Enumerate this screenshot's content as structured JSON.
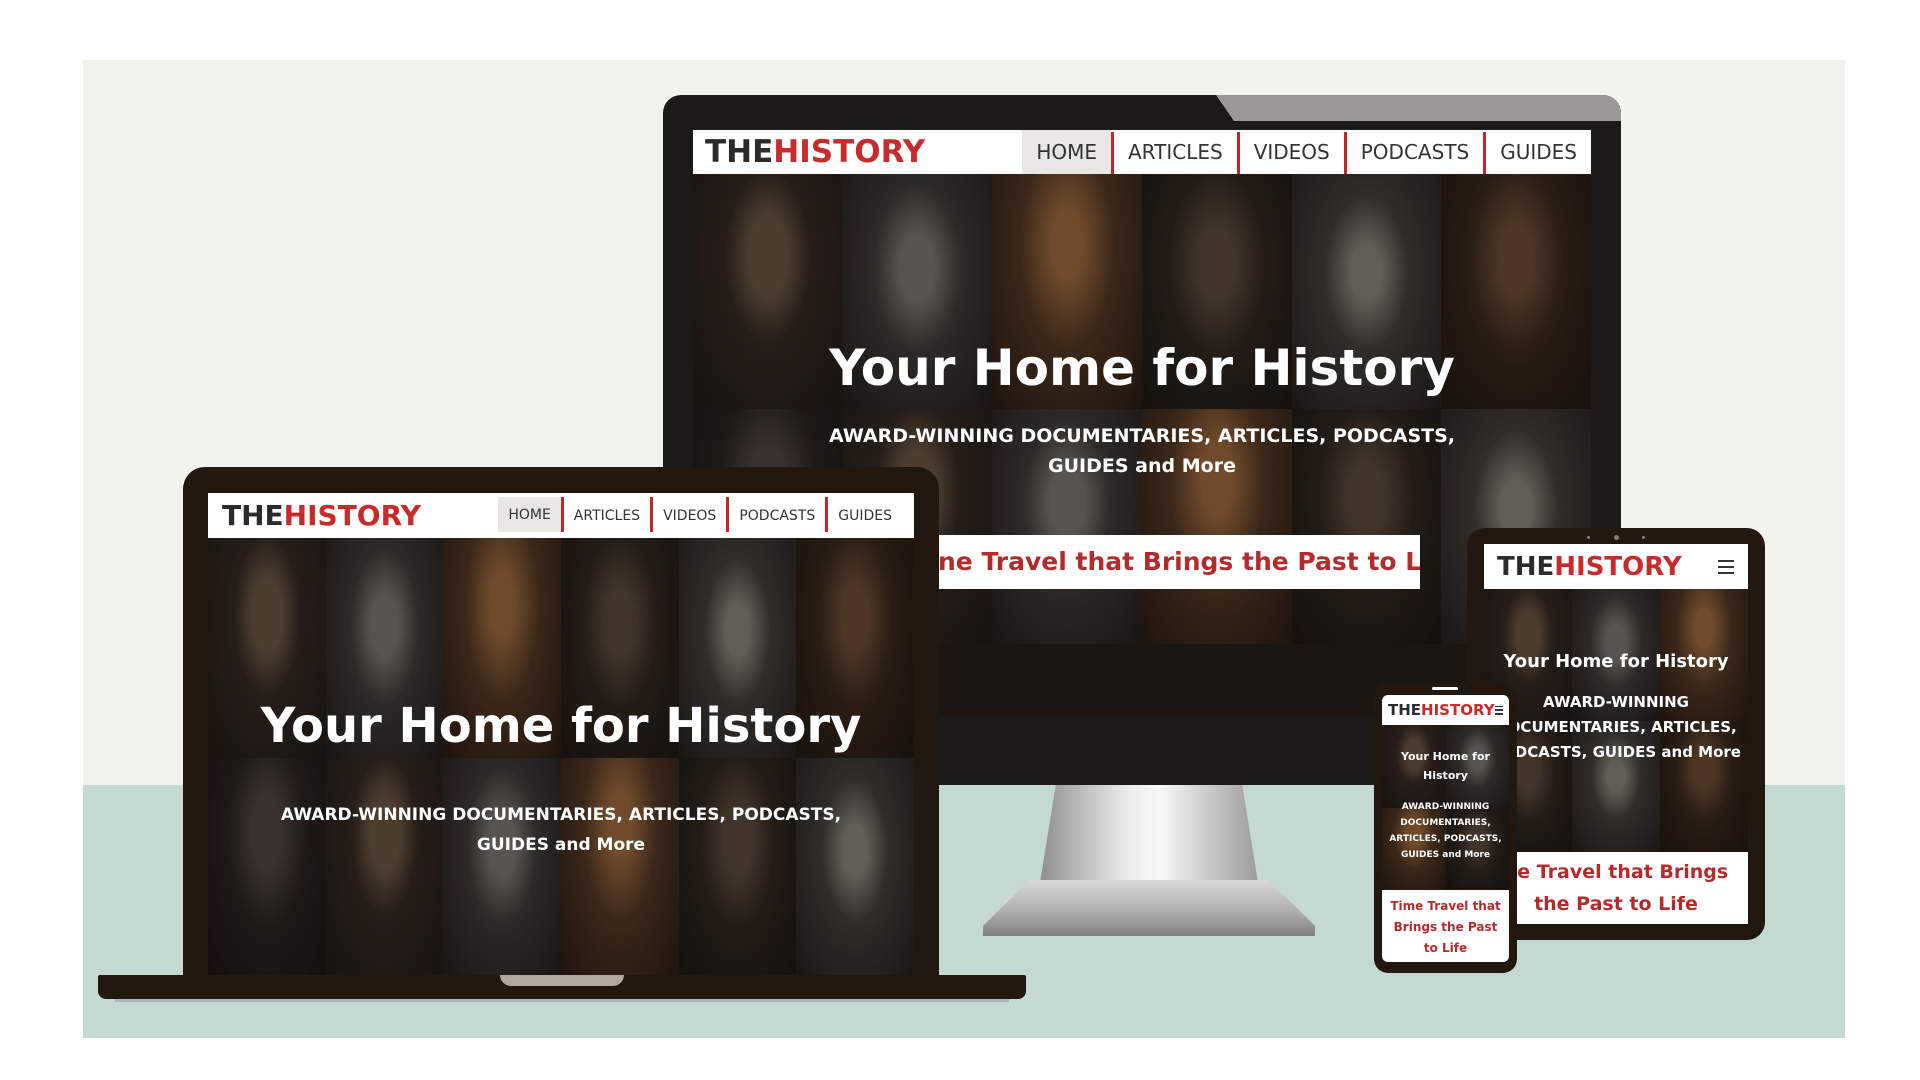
{
  "brand": {
    "logo_the": "THE",
    "logo_history": "HISTORY",
    "accent_color": "#c72b2b"
  },
  "nav": {
    "items": [
      {
        "label": "HOME",
        "active": true
      },
      {
        "label": "ARTICLES",
        "active": false
      },
      {
        "label": "VIDEOS",
        "active": false
      },
      {
        "label": "PODCASTS",
        "active": false
      },
      {
        "label": "GUIDES",
        "active": false
      }
    ]
  },
  "hero": {
    "headline": "Your Home for History",
    "subline_desktop_line1": "AWARD-WINNING DOCUMENTARIES, ARTICLES, PODCASTS,",
    "subline_desktop_line2": "GUIDES and More",
    "subline_tablet": "AWARD-WINNING DOCUMENTARIES, ARTICLES, PODCASTS, GUIDES and More",
    "subline_phone": "AWARD-WINNING DOCUMENTARIES, ARTICLES, PODCASTS, GUIDES and More"
  },
  "cta": {
    "monitor_visible": "ne Travel that Brings the Past to Life",
    "tablet_visible": "ne Travel that Brings the Past to Life",
    "phone": "Time Travel that Brings the Past to Life"
  },
  "icons": {
    "menu": "hamburger-menu-icon"
  },
  "colors": {
    "background": "#f3f3ee",
    "floor": "#c4d9d1",
    "device_frame": "#231810",
    "hero_overlay": "#231d19"
  }
}
